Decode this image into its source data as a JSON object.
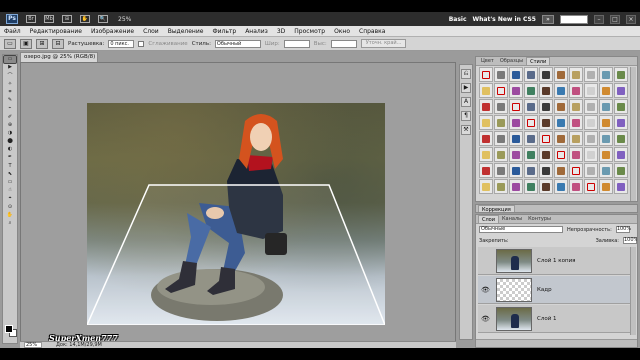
{
  "appbar": {
    "logo": "Ps",
    "icons": [
      "Br",
      "Mb",
      "⊞",
      "✋",
      "🔍"
    ],
    "zoom": "25%",
    "workspace_basic": "Basic",
    "workspace_new": "What's New in CS5",
    "overflow": "»",
    "win_min": "–",
    "win_max": "□",
    "win_close": "×"
  },
  "menubar": {
    "items": [
      "Файл",
      "Редактирование",
      "Изображение",
      "Слои",
      "Выделение",
      "Фильтр",
      "Анализ",
      "3D",
      "Просмотр",
      "Окно",
      "Справка"
    ]
  },
  "options": {
    "feather_label": "Растушевка:",
    "feather_value": "0 пикс.",
    "antialias_label": "Сглаживание",
    "style_label": "Стиль:",
    "style_value": "Обычный",
    "width_label": "Шир:",
    "height_label": "Выс:",
    "refine_button": "Уточн. край..."
  },
  "tools": {
    "items": [
      "▭",
      "▶",
      "⌒",
      "✧",
      "⌗",
      "✎",
      "⌁",
      "✐",
      "⊕",
      "◑",
      "⬤",
      "◐",
      "✒",
      "T",
      "⬉",
      "▭",
      "☝",
      "⌖",
      "⊙",
      "✋",
      "⌕"
    ]
  },
  "document": {
    "tab_title": "озеро.jpg @ 25% (RGB/8) *",
    "watermark": "SuperXmen777",
    "zoom": "25%",
    "doc_info": "Док: 14,1M/29,9M"
  },
  "panels": {
    "swatches_tabs": [
      "Цвет",
      "Образцы",
      "Стили"
    ],
    "active_swatch_tab": "Стили",
    "corrections_tab": "Коррекция",
    "layers_tabs": [
      "Слои",
      "Каналы",
      "Контуры"
    ],
    "blend_mode": "Обычные",
    "opacity_label": "Непрозрачность:",
    "opacity_value": "100%",
    "lock_label": "Закрепить:",
    "fill_label": "Заливка:",
    "fill_value": "100%",
    "layers": [
      {
        "name": "Слой 1 копия",
        "thumb": "photo",
        "visible": false
      },
      {
        "name": "Кадр",
        "thumb": "checker",
        "visible": true
      },
      {
        "name": "Слой 1",
        "thumb": "photo",
        "visible": true
      }
    ]
  },
  "colors": {
    "appbar_bg": "#2d2d2d",
    "canvas_bg": "#9e9e9e",
    "panel_bg": "#d4d4d4"
  }
}
